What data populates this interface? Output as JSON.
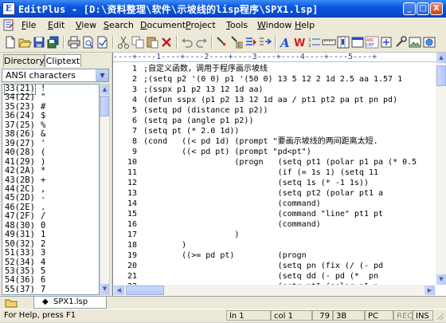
{
  "window": {
    "icon_letter": "E",
    "title": "EditPlus - [D:\\资料整理\\软件\\示坡线的lisp程序\\SPX1.lsp]",
    "minimize": "_",
    "maximize": "□",
    "close": "X"
  },
  "menu": [
    "File",
    "Edit",
    "View",
    "Search",
    "Document",
    "Project",
    "Tools",
    "Window",
    "Help"
  ],
  "toolbar": {
    "icons": [
      "new-file-icon",
      "open-folder-icon",
      "save-icon",
      "save-all-icon",
      "print-icon",
      "print-preview-icon",
      "spell-check-icon",
      "cut-icon",
      "copy-icon",
      "paste-icon",
      "delete-icon",
      "undo-icon",
      "redo-icon",
      "find-icon",
      "replace-icon",
      "go-to-icon",
      "bookmark-icon",
      "font-icon",
      "word-wrap-icon",
      "line-number-icon",
      "ruler-icon",
      "column-select-icon",
      "fullscreen-icon"
    ]
  },
  "left_panel": {
    "tabs": [
      "Directory",
      "Cliptext"
    ],
    "active_tab": "Cliptext",
    "charset": "ANSI characters",
    "chars": [
      {
        "code": "33(21)",
        "glyph": "!"
      },
      {
        "code": "34(22)",
        "glyph": "\""
      },
      {
        "code": "35(23)",
        "glyph": "#"
      },
      {
        "code": "36(24)",
        "glyph": "$"
      },
      {
        "code": "37(25)",
        "glyph": "%"
      },
      {
        "code": "38(26)",
        "glyph": "&"
      },
      {
        "code": "39(27)",
        "glyph": "'"
      },
      {
        "code": "40(28)",
        "glyph": "("
      },
      {
        "code": "41(29)",
        "glyph": ")"
      },
      {
        "code": "42(2A)",
        "glyph": "*"
      },
      {
        "code": "43(2B)",
        "glyph": "+"
      },
      {
        "code": "44(2C)",
        "glyph": ","
      },
      {
        "code": "45(2D)",
        "glyph": "-"
      },
      {
        "code": "46(2E)",
        "glyph": "."
      },
      {
        "code": "47(2F)",
        "glyph": "/"
      },
      {
        "code": "48(30)",
        "glyph": "0"
      },
      {
        "code": "49(31)",
        "glyph": "1"
      },
      {
        "code": "50(32)",
        "glyph": "2"
      },
      {
        "code": "51(33)",
        "glyph": "3"
      },
      {
        "code": "52(34)",
        "glyph": "4"
      },
      {
        "code": "53(35)",
        "glyph": "5"
      },
      {
        "code": "54(36)",
        "glyph": "6"
      },
      {
        "code": "55(37)",
        "glyph": "7"
      }
    ]
  },
  "editor": {
    "ruler": "----+----1----+----2----+----3----+----4----+----5----+",
    "lines": [
      {
        "n": "1",
        "text": ";自定义函数，调用于程序画示坡线"
      },
      {
        "n": "2",
        "text": ";(setq p2 '(0 0) p1 '(50 0) 13 5 12 2 1d 2.5 aa 1.57 1"
      },
      {
        "n": "3",
        "text": ";(sspx p1 p2 13 12 1d aa)"
      },
      {
        "n": "4",
        "text": "(defun sspx (p1 p2 13 12 1d aa / pt1 pt2 pa pt pn pd)"
      },
      {
        "n": "5",
        "text": "(setq pd (distance p1 p2))"
      },
      {
        "n": "6",
        "text": "(setq pa (angle p1 p2))"
      },
      {
        "n": "7",
        "text": "(setq pt (* 2.0 1d))"
      },
      {
        "n": "8",
        "text": "(cond   ((< pd 1d) (prompt \"要画示坡线的两间距离太短."
      },
      {
        "n": "9",
        "text": "        ((< pd pt) (prompt \"pd<pt\")"
      },
      {
        "n": "10",
        "text": "                   (progn   (setq pt1 (polar p1 pa (* 0.5"
      },
      {
        "n": "11",
        "text": "                            (if (= 1s 1) (setq 11"
      },
      {
        "n": "12",
        "text": "                            (setq 1s (* -1 1s))"
      },
      {
        "n": "13",
        "text": "                            (setq pt2 (polar pt1 a"
      },
      {
        "n": "14",
        "text": "                            (command)"
      },
      {
        "n": "15",
        "text": "                            (command \"line\" pt1 pt"
      },
      {
        "n": "16",
        "text": "                            (command)"
      },
      {
        "n": "17",
        "text": "                   )"
      },
      {
        "n": "18",
        "text": "        )"
      },
      {
        "n": "19",
        "text": "        ((>= pd pt)         (progn"
      },
      {
        "n": "20",
        "text": "                            (setq pn (fix (/ (- pd"
      },
      {
        "n": "21",
        "text": "                            (setq dd (- pd (*  pn"
      },
      {
        "n": "22",
        "text": "                            (setq pt1 (polar p1 p"
      }
    ]
  },
  "doc_tab": "SPX1.lsp",
  "status": {
    "help": "For Help, press F1",
    "line": "ln 1",
    "col": "col 1",
    "char": "79",
    "hex": "3B",
    "mode": "PC",
    "rec": "REC",
    "ins": "INS"
  },
  "colors": {
    "title_bar": "#0b55e0",
    "ruler_text": "#2a3f8f",
    "chrome": "#ece9d8"
  }
}
